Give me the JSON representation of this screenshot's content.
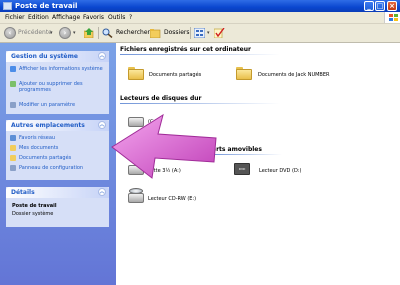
{
  "window": {
    "title": "Poste de travail"
  },
  "menu": [
    "Fichier",
    "Edition",
    "Affichage",
    "Favoris",
    "Outils",
    "?"
  ],
  "toolbar": {
    "back_label": "Précédente",
    "search_label": "Rechercher",
    "folders_label": "Dossiers"
  },
  "sidebar": {
    "system": {
      "title": "Gestion du système",
      "items": [
        {
          "label": "Afficher les informations système",
          "icon": "info-icon"
        },
        {
          "label": "Ajouter ou supprimer des programmes",
          "icon": "add-remove-programs-icon"
        },
        {
          "label": "Modifier un paramètre",
          "icon": "control-panel-icon"
        }
      ]
    },
    "places": {
      "title": "Autres emplacements",
      "items": [
        {
          "label": "Favoris réseau",
          "icon": "network-icon"
        },
        {
          "label": "Mes documents",
          "icon": "my-documents-icon"
        },
        {
          "label": "Documents partagés",
          "icon": "shared-folder-icon"
        },
        {
          "label": "Panneau de configuration",
          "icon": "control-panel-icon"
        }
      ]
    },
    "details": {
      "title": "Détails",
      "name": "Poste de travail",
      "type": "Dossier système"
    }
  },
  "content": {
    "files_section": "Fichiers enregistrés sur cet ordinateur",
    "folders": [
      "Documents partagés",
      "Documents de Jack NUMBER"
    ],
    "drives_section": "Lecteurs de disques dur",
    "local_disk": "(C:)",
    "removable_section_partial": "erts amovibles",
    "floppy_partial": "sette 3½ (A:)",
    "dvd": "Lecteur DVD (D:)",
    "cdrw": "Lecteur CD-RW (E:)"
  },
  "colors": {
    "accent": "#215dc6",
    "titlebar": "#0a47d0",
    "arrow": "#e070d8"
  }
}
